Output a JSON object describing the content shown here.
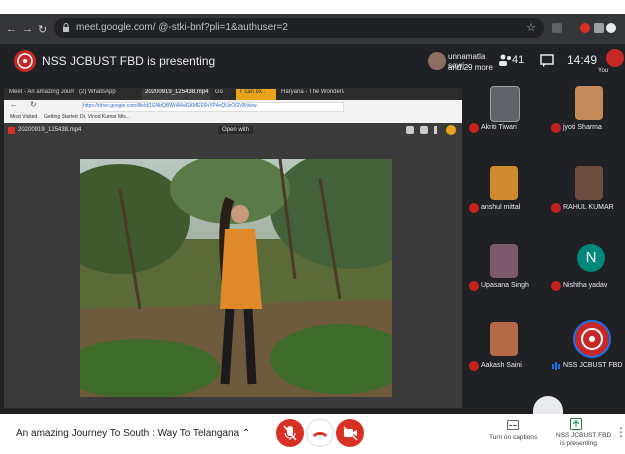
{
  "browser": {
    "url": "meet.google.com/ @-stki-bnf?pli=1&authuser=2"
  },
  "meet": {
    "presenting_text": "NSS JCBUST FBD is presenting",
    "participants_names": "unnamatla sowj...",
    "participants_more": "and 29 more",
    "people_count": "41",
    "clock": "14:49",
    "you_label": "You"
  },
  "shared_screen": {
    "tabs": [
      "Meet - An amazing Journ...",
      "(2) WhatsApp",
      "20200919_125438.mp4",
      "Go",
      "T can ex..",
      "Haryana - The Wonderland o..."
    ],
    "url": "https://drive.google.com/file/d/1ENbQBWrW4aGKMEF6hYP4nQUzOGV8/view",
    "bookmarks": [
      "Most Visited",
      "Getting Started",
      "Dr. Vinod Kumar Mis..."
    ],
    "file_name": "20200919_125438.mp4",
    "open_with": "Open with"
  },
  "participants": [
    {
      "name": "Akriti Tiwari",
      "color": "#5f6368"
    },
    {
      "name": "jyoti Sharma",
      "color": "#c48a5a"
    },
    {
      "name": "anshul mittal",
      "color": "#d08b2e"
    },
    {
      "name": "RAHUL KUMAR",
      "color": "#6b4e3d"
    },
    {
      "name": "Upasana Singh",
      "color": "#7a5a6b"
    },
    {
      "name": "Nishtha yadav",
      "initial": "N",
      "color": "#00897b"
    },
    {
      "name": "Aakash Saini",
      "color": "#b56a4a"
    },
    {
      "name": "NSS JCBUST FBD",
      "color": "#c62828"
    }
  ],
  "bottom": {
    "meeting_title": "An amazing Journey To South : Way To Telangana",
    "captions_label": "Turn on captions",
    "present_label_1": "NSS JCBUST FBD",
    "present_label_2": "is presenting"
  },
  "colors": {
    "end_call": "#ffffff",
    "mic_off": "#d93025",
    "dark": "#202124"
  }
}
